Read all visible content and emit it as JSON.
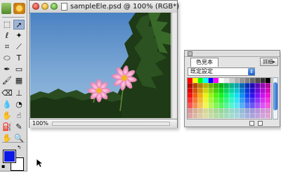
{
  "toolbox": {
    "tools": [
      {
        "name": "marquee-tool-icon",
        "glyph": "⬚"
      },
      {
        "name": "move-tool-icon",
        "glyph": "➚"
      },
      {
        "name": "lasso-tool-icon",
        "glyph": "ℓ"
      },
      {
        "name": "magic-wand-tool-icon",
        "glyph": "✦"
      },
      {
        "name": "crop-tool-icon",
        "glyph": "⌗"
      },
      {
        "name": "slice-tool-icon",
        "glyph": "⟋"
      },
      {
        "name": "ellipse-tool-icon",
        "glyph": "⬭"
      },
      {
        "name": "type-tool-icon",
        "glyph": "T"
      },
      {
        "name": "pen-tool-icon",
        "glyph": "✒"
      },
      {
        "name": "rectangle-tool-icon",
        "glyph": "▭"
      },
      {
        "name": "brush-tool-icon",
        "glyph": "🖌"
      },
      {
        "name": "gradient-tool-icon",
        "glyph": "▦"
      },
      {
        "name": "eraser-tool-icon",
        "glyph": "⌫"
      },
      {
        "name": "clone-stamp-tool-icon",
        "glyph": "⊥"
      },
      {
        "name": "blur-tool-icon",
        "glyph": "💧"
      },
      {
        "name": "dodge-tool-icon",
        "glyph": "◔"
      },
      {
        "name": "burn-tool-icon",
        "glyph": "✋"
      },
      {
        "name": "smudge-tool-icon",
        "glyph": "☝"
      },
      {
        "name": "paint-bucket-tool-icon",
        "glyph": "⛽"
      },
      {
        "name": "eyedropper-tool-icon",
        "glyph": "✎"
      },
      {
        "name": "hand-tool-icon",
        "glyph": "✋"
      },
      {
        "name": "zoom-tool-icon",
        "glyph": "🔍"
      }
    ],
    "selected_tool": "move-tool-icon",
    "foreground_color": "#0a17e6",
    "background_color": "#ffffff"
  },
  "document": {
    "title": "sampleEle.psd @ 100% (RGB*)",
    "zoom": "100%"
  },
  "swatches_palette": {
    "tab_label": "色見本",
    "menu_button": "詳細▸",
    "preset_select": "既定設定",
    "select_arrow": "⇕"
  }
}
